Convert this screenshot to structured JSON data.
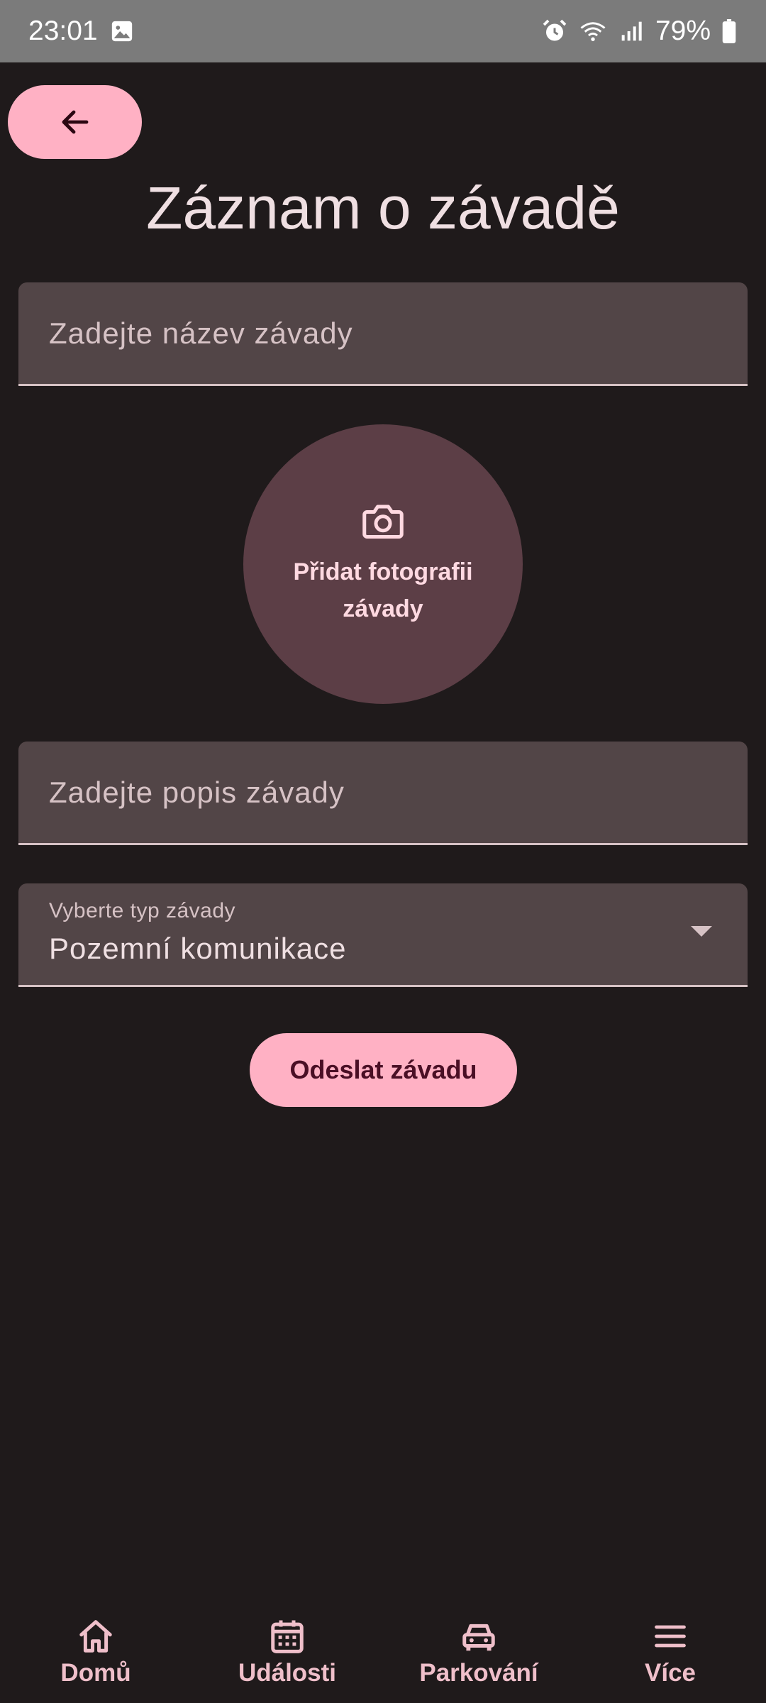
{
  "status_bar": {
    "time": "23:01",
    "battery": "79%",
    "icons": [
      "gallery-icon",
      "alarm-icon",
      "wifi-icon",
      "signal-icon",
      "battery-icon"
    ]
  },
  "back_button": {
    "icon": "arrow-left-icon"
  },
  "page": {
    "title": "Záznam o závadě"
  },
  "form": {
    "name_placeholder": "Zadejte název závady",
    "photo_label": "Přidat fotografii závady",
    "photo_icon": "camera-icon",
    "description_placeholder": "Zadejte popis závady",
    "type_label": "Vyberte typ závady",
    "type_value": "Pozemní komunikace",
    "submit_label": "Odeslat závadu"
  },
  "bottom_nav": {
    "items": [
      {
        "label": "Domů",
        "icon": "home-icon"
      },
      {
        "label": "Události",
        "icon": "calendar-icon"
      },
      {
        "label": "Parkování",
        "icon": "car-icon"
      },
      {
        "label": "Více",
        "icon": "menu-icon"
      }
    ]
  },
  "colors": {
    "background": "#1f1a1b",
    "accent": "#ffb1c4",
    "field": "#524547",
    "photo_circle": "#5c3e46",
    "status_bar": "#7b7b7b"
  }
}
